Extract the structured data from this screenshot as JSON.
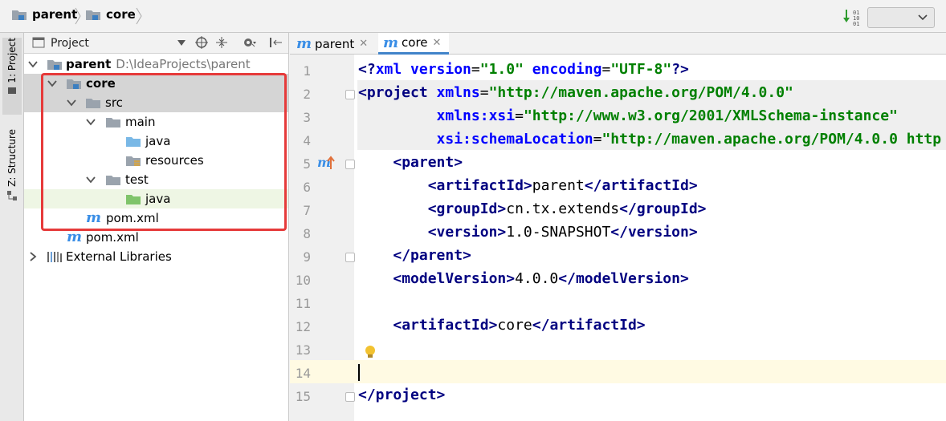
{
  "breadcrumb": {
    "items": [
      "parent",
      "core"
    ]
  },
  "project_panel": {
    "title": "Project",
    "tree": [
      {
        "label": "parent",
        "path": "D:\\IdeaProjects\\parent"
      },
      {
        "label": "core"
      },
      {
        "label": "src"
      },
      {
        "label": "main"
      },
      {
        "label": "java"
      },
      {
        "label": "resources"
      },
      {
        "label": "test"
      },
      {
        "label": "java"
      },
      {
        "label": "pom.xml"
      },
      {
        "label": "pom.xml"
      },
      {
        "label": "External Libraries"
      }
    ]
  },
  "tool_strip": {
    "project_tab": "1: Project",
    "structure_tab": "Z: Structure"
  },
  "editor": {
    "tabs": [
      {
        "label": "parent",
        "icon": "maven-m-icon"
      },
      {
        "label": "core",
        "icon": "maven-m-icon"
      }
    ],
    "line_numbers": [
      "1",
      "2",
      "3",
      "4",
      "5",
      "6",
      "7",
      "8",
      "9",
      "10",
      "11",
      "12",
      "13",
      "14",
      "15"
    ],
    "xml": {
      "version": "\"1.0\"",
      "encoding": "\"UTF-8\"",
      "xmlns": "\"http://maven.apache.org/POM/4.0.0\"",
      "xmlns_xsi": "\"http://www.w3.org/2001/XMLSchema-instance\"",
      "schema_location": "\"http://maven.apache.org/POM/4.0.0 http",
      "parent_artifact_id": "parent",
      "parent_group_id": "cn.tx.extends",
      "parent_version": "1.0-SNAPSHOT",
      "model_version": "4.0.0",
      "artifact_id": "core"
    }
  },
  "colors": {
    "tag": "#000080",
    "attribute": "#0000ff",
    "string": "#008000",
    "highlight": "#e63a3a",
    "current_line": "#fffae3"
  }
}
